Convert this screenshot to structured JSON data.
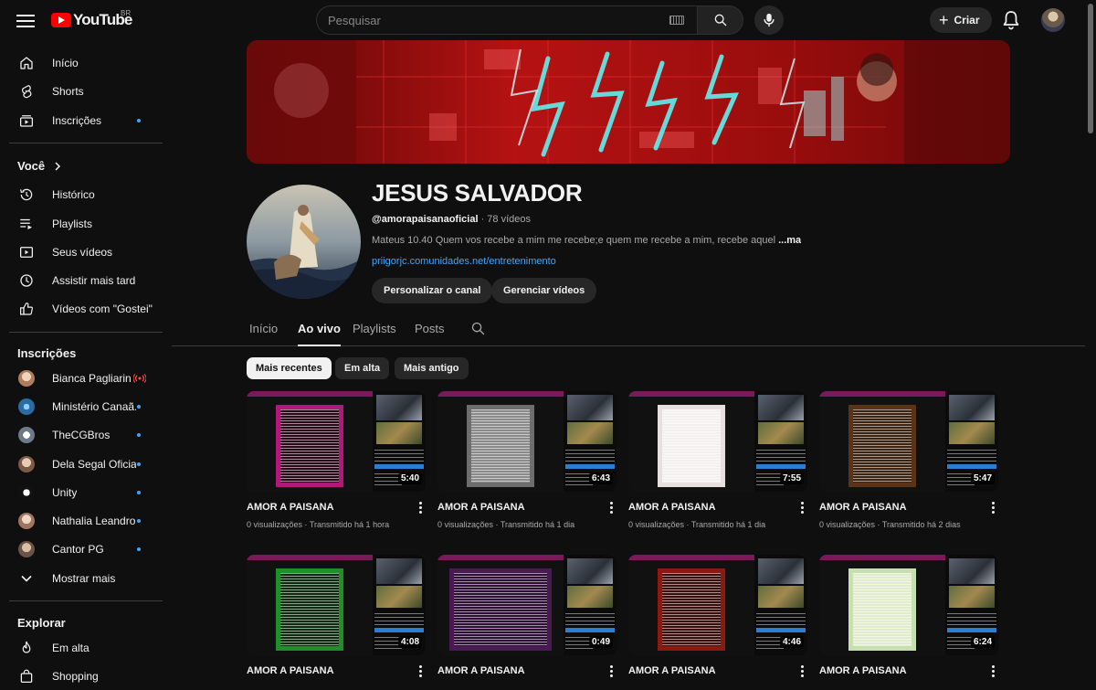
{
  "topbar": {
    "logo_text": "YouTube",
    "country_code": "BR",
    "search_placeholder": "Pesquisar",
    "create_label": "Criar"
  },
  "sidebar": {
    "main": [
      {
        "label": "Início",
        "icon": "home-icon"
      },
      {
        "label": "Shorts",
        "icon": "shorts-icon"
      },
      {
        "label": "Inscrições",
        "icon": "subscriptions-icon",
        "dot": true
      }
    ],
    "you_header": "Você",
    "you": [
      {
        "label": "Histórico",
        "icon": "history-icon"
      },
      {
        "label": "Playlists",
        "icon": "playlists-icon"
      },
      {
        "label": "Seus vídeos",
        "icon": "your-videos-icon"
      },
      {
        "label": "Assistir mais tarde",
        "icon": "watch-later-icon"
      },
      {
        "label": "Vídeos com \"Gostei\"",
        "icon": "liked-icon"
      }
    ],
    "subs_header": "Inscrições",
    "subs": [
      {
        "label": "Bianca Pagliarin",
        "live": true,
        "color": "#c9a08a"
      },
      {
        "label": "Ministério Canaã...",
        "dot": true,
        "color": "#2c6aa3"
      },
      {
        "label": "TheCGBros",
        "dot": true,
        "color": "#6d7a8a"
      },
      {
        "label": "Dela Segal Oficial",
        "dot": true,
        "color": "#b58f76"
      },
      {
        "label": "Unity",
        "dot": true,
        "color": "#111111"
      },
      {
        "label": "Nathalia Leandro",
        "dot": true,
        "color": "#c89a84"
      },
      {
        "label": "Cantor PG",
        "dot": true,
        "color": "#8a6e5e"
      }
    ],
    "show_more": "Mostrar mais",
    "explore_header": "Explorar",
    "explore": [
      {
        "label": "Em alta",
        "icon": "trending-icon"
      },
      {
        "label": "Shopping",
        "icon": "shopping-icon"
      }
    ]
  },
  "channel": {
    "title": "JESUS SALVADOR",
    "handle": "@amorapaisanaoficial",
    "video_count": "· 78 vídeos",
    "description": "Mateus 10.40 Quem vos recebe a mim me recebe;e quem me recebe a mim, recebe aquel",
    "more_label": "...mais",
    "link": "priigorjc.comunidades.net/entretenimento",
    "customize_label": "Personalizar o canal",
    "manage_label": "Gerenciar vídeos"
  },
  "tabs": [
    {
      "label": "Início"
    },
    {
      "label": "Ao vivo",
      "active": true
    },
    {
      "label": "Playlists"
    },
    {
      "label": "Posts"
    }
  ],
  "chips": [
    {
      "label": "Mais recentes",
      "active": true
    },
    {
      "label": "Em alta"
    },
    {
      "label": "Mais antigo"
    }
  ],
  "videos": [
    {
      "title": "AMOR A PAISANA",
      "meta": "0 visualizações · Transmitido há 1 hora",
      "duration": "5:40",
      "doc_bg": "#b0187a",
      "doc_inner": "#2a0a1a",
      "doc_w": 74
    },
    {
      "title": "AMOR A PAISANA",
      "meta": "0 visualizações · Transmitido há 1 dia",
      "duration": "6:43",
      "doc_bg": "#6e6e6e",
      "doc_inner": "#8a8a8a",
      "doc_w": 74
    },
    {
      "title": "AMOR A PAISANA",
      "meta": "0 visualizações · Transmitido há 1 dia",
      "duration": "7:55",
      "doc_bg": "#e8e0e0",
      "doc_inner": "#f4f0f0",
      "doc_w": 74
    },
    {
      "title": "AMOR A PAISANA",
      "meta": "0 visualizações · Transmitido há 2 dias",
      "duration": "5:47",
      "doc_bg": "#5a3318",
      "doc_inner": "#3c2412",
      "doc_w": 74
    },
    {
      "title": "AMOR A PAISANA",
      "meta": "",
      "duration": "4:08",
      "doc_bg": "#1f8f2a",
      "doc_inner": "#0e2a10",
      "doc_w": 74
    },
    {
      "title": "AMOR A PAISANA",
      "meta": "",
      "duration": "0:49",
      "doc_bg": "#4a1a55",
      "doc_inner": "#2e0f36",
      "doc_w": 112
    },
    {
      "title": "AMOR A PAISANA",
      "meta": "",
      "duration": "4:46",
      "doc_bg": "#8a1a10",
      "doc_inner": "#3a0e0a",
      "doc_w": 74
    },
    {
      "title": "AMOR A PAISANA",
      "meta": "",
      "duration": "6:24",
      "doc_bg": "#c7e0b0",
      "doc_inner": "#e0eccc",
      "doc_w": 74
    }
  ]
}
